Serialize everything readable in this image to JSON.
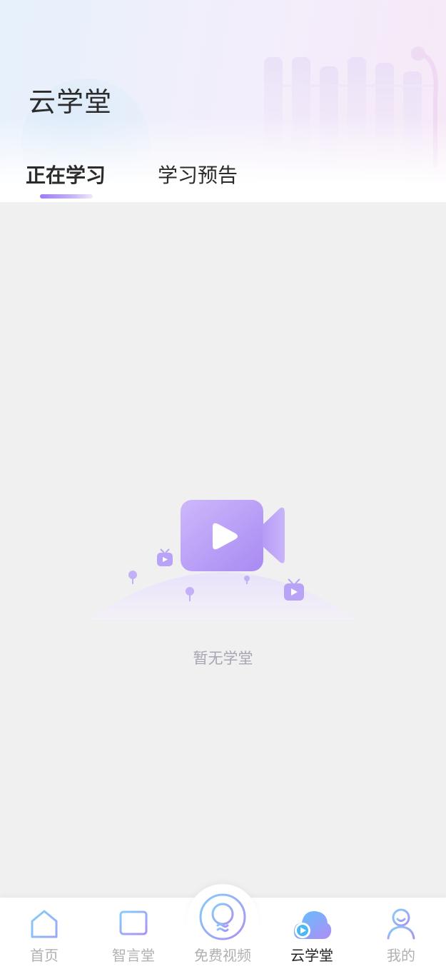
{
  "header": {
    "title": "云学堂",
    "tabs": [
      {
        "label": "正在学习",
        "active": true
      },
      {
        "label": "学习预告",
        "active": false
      }
    ]
  },
  "empty_state": {
    "message": "暂无学堂",
    "illustration_icon": "video-camera-icon"
  },
  "bottom_nav": {
    "items": [
      {
        "label": "首页",
        "icon": "home-icon",
        "active": false
      },
      {
        "label": "智言堂",
        "icon": "book-icon",
        "active": false
      },
      {
        "label": "免费视频",
        "icon": "lightbulb-icon",
        "active": false
      },
      {
        "label": "云学堂",
        "icon": "cloud-play-icon",
        "active": true
      },
      {
        "label": "我的",
        "icon": "user-icon",
        "active": false
      }
    ]
  },
  "colors": {
    "accent_purple": "#9b7cf2",
    "icon_blue": "#7cc4f7",
    "text_dark": "#2b2b2b",
    "text_muted": "#b0b0b0",
    "background": "#f0f0f0"
  }
}
